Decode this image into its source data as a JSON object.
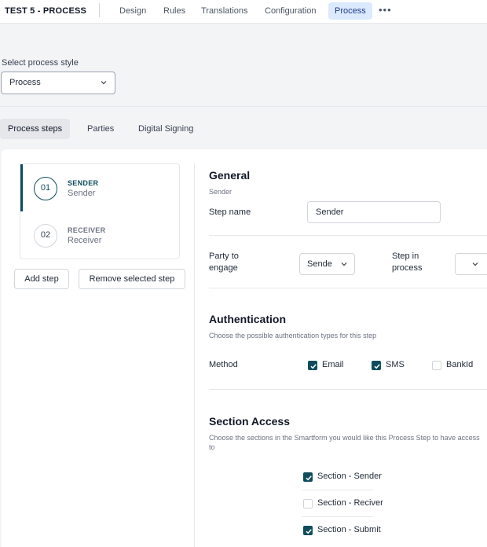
{
  "header": {
    "title": "TEST 5 - PROCESS",
    "tabs": [
      "Design",
      "Rules",
      "Translations",
      "Configuration",
      "Process"
    ],
    "active_tab": "Process",
    "more_label": "•••"
  },
  "process_style": {
    "label": "Select process style",
    "value": "Process"
  },
  "sub_tabs": [
    "Process steps",
    "Parties",
    "Digital Signing"
  ],
  "steps": [
    {
      "number": "01",
      "role": "SENDER",
      "name": "Sender"
    },
    {
      "number": "02",
      "role": "RECEIVER",
      "name": "Receiver"
    }
  ],
  "step_buttons": {
    "add": "Add step",
    "remove": "Remove selected step"
  },
  "general": {
    "title": "General",
    "subtitle": "Sender",
    "step_name_label": "Step name",
    "step_name_value": "Sender",
    "party_label": "Party to engage",
    "party_value": "Sende",
    "step_in_process_label": "Step in process",
    "step_in_process_value": ""
  },
  "authentication": {
    "title": "Authentication",
    "subtitle": "Choose the possible authentication types for this step",
    "method_label": "Method",
    "options": [
      {
        "label": "Email",
        "checked": true
      },
      {
        "label": "SMS",
        "checked": true
      },
      {
        "label": "BankId",
        "checked": false
      }
    ]
  },
  "section_access": {
    "title": "Section Access",
    "subtitle": "Choose the sections in the Smartform you would like this Process Step to have access to",
    "sections": [
      {
        "label": "Section - Sender",
        "checked": true
      },
      {
        "label": "Section - Reciver",
        "checked": false
      },
      {
        "label": "Section - Submit",
        "checked": true
      }
    ]
  },
  "colors": {
    "accent": "#0f4c5c",
    "active_tab_bg": "#dbeafe",
    "page_bg": "#f3f4f6"
  }
}
